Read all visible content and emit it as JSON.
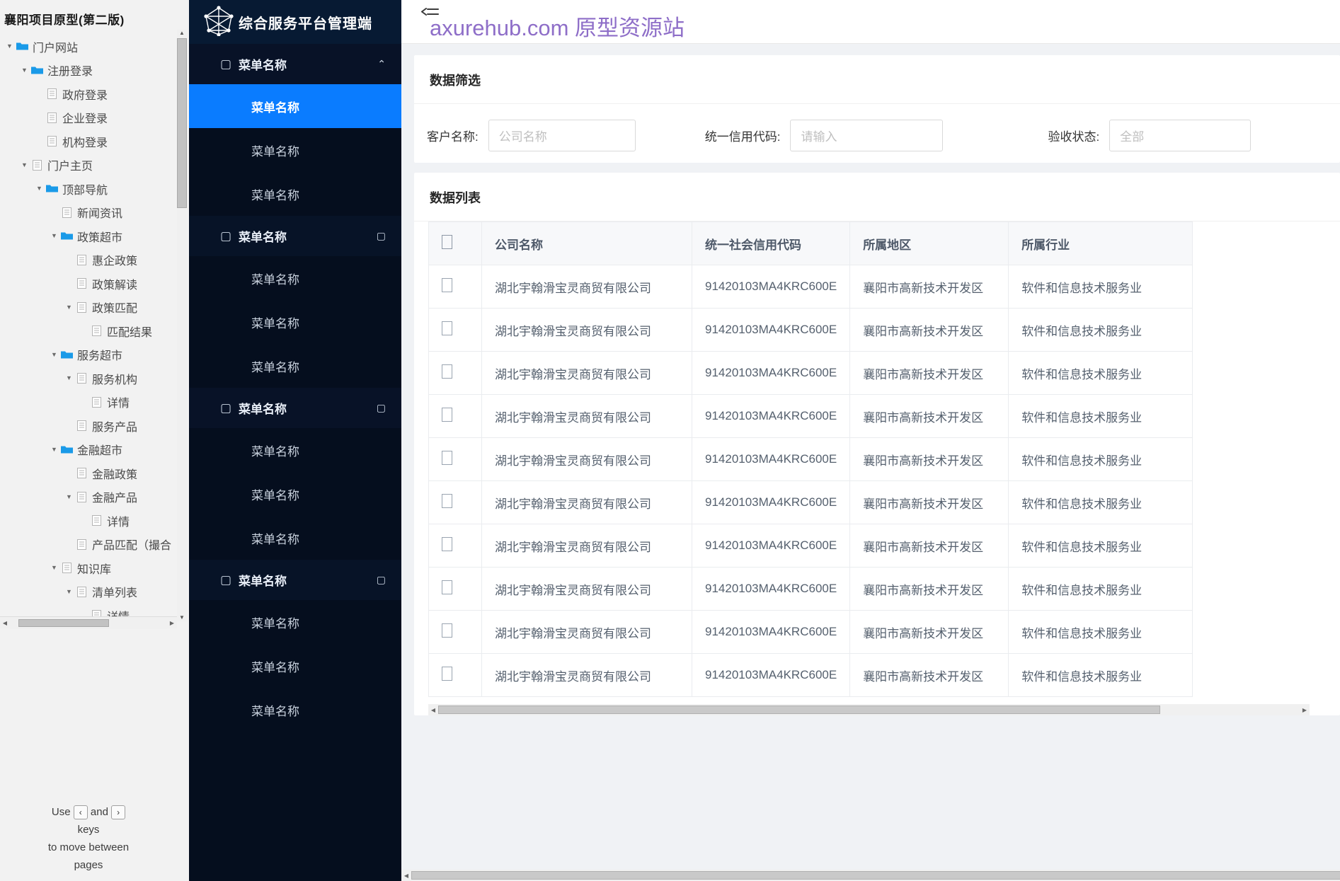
{
  "sitemap": {
    "title": "襄阳项目原型(第二版)",
    "nodes": [
      {
        "label": "门户网站",
        "depth": 0,
        "arrow": "▼",
        "icon": "folder"
      },
      {
        "label": "注册登录",
        "depth": 1,
        "arrow": "▼",
        "icon": "folder"
      },
      {
        "label": "政府登录",
        "depth": 2,
        "arrow": "",
        "icon": "page"
      },
      {
        "label": "企业登录",
        "depth": 2,
        "arrow": "",
        "icon": "page"
      },
      {
        "label": "机构登录",
        "depth": 2,
        "arrow": "",
        "icon": "page"
      },
      {
        "label": "门户主页",
        "depth": 1,
        "arrow": "▼",
        "icon": "page"
      },
      {
        "label": "顶部导航",
        "depth": 2,
        "arrow": "▼",
        "icon": "folder"
      },
      {
        "label": "新闻资讯",
        "depth": 3,
        "arrow": "",
        "icon": "page"
      },
      {
        "label": "政策超市",
        "depth": 3,
        "arrow": "▼",
        "icon": "folder"
      },
      {
        "label": "惠企政策",
        "depth": 4,
        "arrow": "",
        "icon": "page"
      },
      {
        "label": "政策解读",
        "depth": 4,
        "arrow": "",
        "icon": "page"
      },
      {
        "label": "政策匹配",
        "depth": 4,
        "arrow": "▼",
        "icon": "page"
      },
      {
        "label": "匹配结果",
        "depth": 5,
        "arrow": "",
        "icon": "page"
      },
      {
        "label": "服务超市",
        "depth": 3,
        "arrow": "▼",
        "icon": "folder"
      },
      {
        "label": "服务机构",
        "depth": 4,
        "arrow": "▼",
        "icon": "page"
      },
      {
        "label": "详情",
        "depth": 5,
        "arrow": "",
        "icon": "page"
      },
      {
        "label": "服务产品",
        "depth": 4,
        "arrow": "",
        "icon": "page"
      },
      {
        "label": "金融超市",
        "depth": 3,
        "arrow": "▼",
        "icon": "folder"
      },
      {
        "label": "金融政策",
        "depth": 4,
        "arrow": "",
        "icon": "page"
      },
      {
        "label": "金融产品",
        "depth": 4,
        "arrow": "▼",
        "icon": "page"
      },
      {
        "label": "详情",
        "depth": 5,
        "arrow": "",
        "icon": "page"
      },
      {
        "label": "产品匹配（撮合",
        "depth": 4,
        "arrow": "",
        "icon": "page"
      },
      {
        "label": "知识库",
        "depth": 3,
        "arrow": "▼",
        "icon": "page"
      },
      {
        "label": "清单列表",
        "depth": 4,
        "arrow": "▼",
        "icon": "page"
      },
      {
        "label": "详情",
        "depth": 5,
        "arrow": "",
        "icon": "page"
      }
    ],
    "hint": {
      "line1_a": "Use",
      "key_prev": "‹",
      "line1_b": "and",
      "key_next": "›",
      "line2": "keys",
      "line3": "to move between",
      "line4": "pages"
    }
  },
  "nav": {
    "brand": "综合服务平台管理端",
    "sections": [
      {
        "label": "菜单名称",
        "chevron": "⌃",
        "leading": "▢",
        "items": [
          {
            "label": "菜单名称",
            "active": true
          },
          {
            "label": "菜单名称",
            "active": false
          },
          {
            "label": "菜单名称",
            "active": false
          }
        ]
      },
      {
        "label": "菜单名称",
        "chevron": "▢",
        "leading": "▢",
        "items": [
          {
            "label": "菜单名称",
            "active": false
          },
          {
            "label": "菜单名称",
            "active": false
          },
          {
            "label": "菜单名称",
            "active": false
          }
        ]
      },
      {
        "label": "菜单名称",
        "chevron": "▢",
        "leading": "▢",
        "items": [
          {
            "label": "菜单名称",
            "active": false
          },
          {
            "label": "菜单名称",
            "active": false
          },
          {
            "label": "菜单名称",
            "active": false
          }
        ]
      },
      {
        "label": "菜单名称",
        "chevron": "▢",
        "leading": "▢",
        "items": [
          {
            "label": "菜单名称",
            "active": false
          },
          {
            "label": "菜单名称",
            "active": false
          },
          {
            "label": "菜单名称",
            "active": false
          }
        ]
      }
    ]
  },
  "topbar": {
    "collapse_icon": "menu-fold-icon",
    "watermark": "axurehub.com 原型资源站"
  },
  "filter": {
    "title": "数据筛选",
    "fields": [
      {
        "label": "客户名称:",
        "placeholder": "公司名称",
        "value": ""
      },
      {
        "label": "统一信用代码:",
        "placeholder": "请输入",
        "value": ""
      },
      {
        "label": "验收状态:",
        "placeholder": "全部",
        "value": ""
      }
    ]
  },
  "list": {
    "title": "数据列表",
    "columns": [
      "",
      "公司名称",
      "统一社会信用代码",
      "所属地区",
      "所属行业"
    ],
    "rows": [
      [
        "",
        "湖北宇翰滑宝灵商贸有限公司",
        "91420103MA4KRC600E",
        "襄阳市高新技术开发区",
        "软件和信息技术服务业"
      ],
      [
        "",
        "湖北宇翰滑宝灵商贸有限公司",
        "91420103MA4KRC600E",
        "襄阳市高新技术开发区",
        "软件和信息技术服务业"
      ],
      [
        "",
        "湖北宇翰滑宝灵商贸有限公司",
        "91420103MA4KRC600E",
        "襄阳市高新技术开发区",
        "软件和信息技术服务业"
      ],
      [
        "",
        "湖北宇翰滑宝灵商贸有限公司",
        "91420103MA4KRC600E",
        "襄阳市高新技术开发区",
        "软件和信息技术服务业"
      ],
      [
        "",
        "湖北宇翰滑宝灵商贸有限公司",
        "91420103MA4KRC600E",
        "襄阳市高新技术开发区",
        "软件和信息技术服务业"
      ],
      [
        "",
        "湖北宇翰滑宝灵商贸有限公司",
        "91420103MA4KRC600E",
        "襄阳市高新技术开发区",
        "软件和信息技术服务业"
      ],
      [
        "",
        "湖北宇翰滑宝灵商贸有限公司",
        "91420103MA4KRC600E",
        "襄阳市高新技术开发区",
        "软件和信息技术服务业"
      ],
      [
        "",
        "湖北宇翰滑宝灵商贸有限公司",
        "91420103MA4KRC600E",
        "襄阳市高新技术开发区",
        "软件和信息技术服务业"
      ],
      [
        "",
        "湖北宇翰滑宝灵商贸有限公司",
        "91420103MA4KRC600E",
        "襄阳市高新技术开发区",
        "软件和信息技术服务业"
      ],
      [
        "",
        "湖北宇翰滑宝灵商贸有限公司",
        "91420103MA4KRC600E",
        "襄阳市高新技术开发区",
        "软件和信息技术服务业"
      ]
    ]
  },
  "colors": {
    "nav_bg": "#050e1e",
    "nav_brand_bg": "#071a33",
    "accent": "#0a7cff",
    "watermark": "#8e6ec8",
    "page_bg": "#f0f2f5",
    "tree_folder": "#1a9ae8"
  }
}
